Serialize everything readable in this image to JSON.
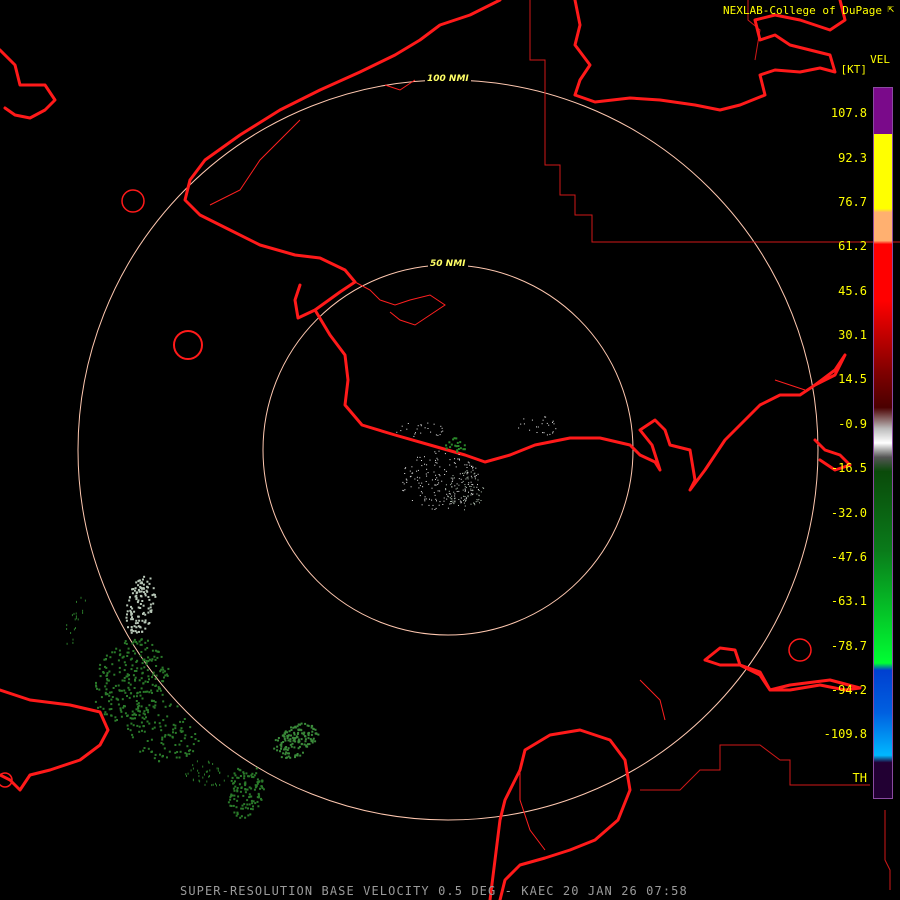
{
  "credit": "NEXLAB-College of DuPage",
  "credit_mark": "⇱",
  "caption": "SUPER-RESOLUTION BASE VELOCITY 0.5 DEG - KAEC 20 JAN 26 07:58",
  "legend": {
    "product": "VEL",
    "unit": "[KT]",
    "labels": [
      "107.8",
      "92.3",
      "76.7",
      "61.2",
      "45.6",
      "30.1",
      "14.5",
      "-0.9",
      "-16.5",
      "-32.0",
      "-47.6",
      "-63.1",
      "-78.7",
      "-94.2",
      "-109.8",
      "TH"
    ],
    "colors": {
      "purple": "#7a0a8a",
      "yellow": "#ffff00",
      "orange": "#ffb070",
      "red": "#ff0000",
      "dark_red": "#4a0000",
      "gray": "#bdbdbd",
      "green": "#00ff33",
      "dark_green": "#0a4a0a",
      "blue": "#0040d0",
      "cyan": "#00b8ff",
      "th": "#220033"
    }
  },
  "range_rings": [
    {
      "label": "50 NMI",
      "range_nmi": 50
    },
    {
      "label": "100 NMI",
      "range_nmi": 100
    }
  ],
  "colors": {
    "coastline": "#ff1a1a",
    "border": "#e02020",
    "ring": "#ffc8b0",
    "echo_green": "#2a7a2a",
    "echo_gray": "#b8c8b8",
    "echo_white": "#e8e8e8"
  }
}
